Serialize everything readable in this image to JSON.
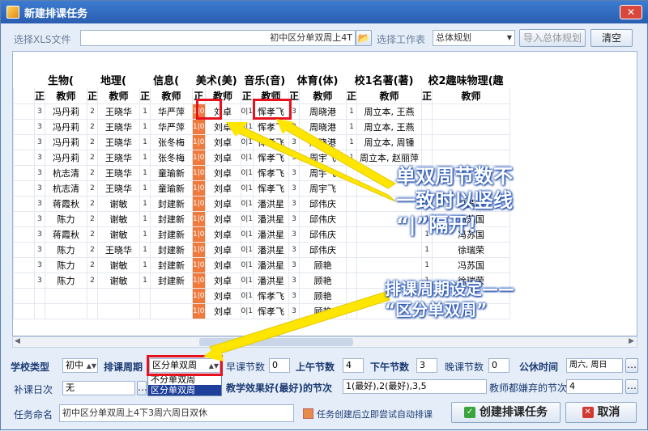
{
  "window": {
    "title": "新建排课任务"
  },
  "top": {
    "xls_label": "选择XLS文件",
    "xls_value": "初中区分单双周上4T",
    "sheet_label": "选择工作表",
    "sheet_value": "总体规划",
    "import_label": "导入总体规划",
    "clear_label": "清空"
  },
  "grid": {
    "subjects": [
      "生物(",
      "地理(",
      "信息(",
      "美术(美)",
      "音乐(音)",
      "体育(体)",
      "校1名著(著)",
      "校2趣味物理(趣"
    ],
    "sub_headers": [
      "正",
      "教师"
    ],
    "rows": [
      [
        [
          "3",
          "冯丹莉"
        ],
        [
          "2",
          "王晓华"
        ],
        [
          "1",
          "华严萍"
        ],
        [
          "1|0",
          "刘卓"
        ],
        [
          "0|1",
          "恽孝飞"
        ],
        [
          "3",
          "周晓港"
        ],
        [
          "1",
          "周立本, 王燕"
        ],
        [
          "",
          ""
        ]
      ],
      [
        [
          "3",
          "冯丹莉"
        ],
        [
          "2",
          "王晓华"
        ],
        [
          "1",
          "华严萍"
        ],
        [
          "1|0",
          "刘卓"
        ],
        [
          "0|1",
          "恽孝飞"
        ],
        [
          "3",
          "周晓港"
        ],
        [
          "1",
          "周立本, 王燕"
        ],
        [
          "",
          ""
        ]
      ],
      [
        [
          "3",
          "冯丹莉"
        ],
        [
          "2",
          "王晓华"
        ],
        [
          "1",
          "张冬梅"
        ],
        [
          "1|0",
          "刘卓"
        ],
        [
          "0|1",
          "恽孝飞"
        ],
        [
          "3",
          "周晓港"
        ],
        [
          "1",
          "周立本, 周锺"
        ],
        [
          "",
          ""
        ]
      ],
      [
        [
          "3",
          "冯丹莉"
        ],
        [
          "2",
          "王晓华"
        ],
        [
          "1",
          "张冬梅"
        ],
        [
          "1|0",
          "刘卓"
        ],
        [
          "0|1",
          "恽孝飞"
        ],
        [
          "3",
          "周宇飞"
        ],
        [
          "1",
          "周立本, 赵丽萍"
        ],
        [
          "",
          ""
        ]
      ],
      [
        [
          "3",
          "杭志清"
        ],
        [
          "2",
          "王晓华"
        ],
        [
          "1",
          "童瑜新"
        ],
        [
          "1|0",
          "刘卓"
        ],
        [
          "0|1",
          "恽孝飞"
        ],
        [
          "3",
          "周宇飞"
        ],
        [
          "",
          ""
        ],
        [
          "",
          ""
        ]
      ],
      [
        [
          "3",
          "杭志清"
        ],
        [
          "2",
          "王晓华"
        ],
        [
          "1",
          "童瑜新"
        ],
        [
          "1|0",
          "刘卓"
        ],
        [
          "0|1",
          "恽孝飞"
        ],
        [
          "3",
          "周宇飞"
        ],
        [
          "",
          ""
        ],
        [
          "",
          ""
        ]
      ],
      [
        [
          "3",
          "蒋霞秋"
        ],
        [
          "2",
          "谢敏"
        ],
        [
          "1",
          "封建新"
        ],
        [
          "1|0",
          "刘卓"
        ],
        [
          "0|1",
          "潘洪星"
        ],
        [
          "3",
          "邱伟庆"
        ],
        [
          "",
          ""
        ],
        [
          "1",
          "冯苏国"
        ]
      ],
      [
        [
          "3",
          "陈力"
        ],
        [
          "2",
          "谢敏"
        ],
        [
          "1",
          "封建新"
        ],
        [
          "1|0",
          "刘卓"
        ],
        [
          "0|1",
          "潘洪星"
        ],
        [
          "3",
          "邱伟庆"
        ],
        [
          "",
          ""
        ],
        [
          "1",
          "冯苏国"
        ]
      ],
      [
        [
          "3",
          "蒋霞秋"
        ],
        [
          "2",
          "谢敏"
        ],
        [
          "1",
          "封建新"
        ],
        [
          "1|0",
          "刘卓"
        ],
        [
          "0|1",
          "潘洪星"
        ],
        [
          "3",
          "邱伟庆"
        ],
        [
          "",
          ""
        ],
        [
          "1",
          "冯苏国"
        ]
      ],
      [
        [
          "3",
          "陈力"
        ],
        [
          "2",
          "王晓华"
        ],
        [
          "1",
          "封建新"
        ],
        [
          "1|0",
          "刘卓"
        ],
        [
          "0|1",
          "潘洪星"
        ],
        [
          "3",
          "邱伟庆"
        ],
        [
          "",
          ""
        ],
        [
          "1",
          "徐瑞荣"
        ]
      ],
      [
        [
          "3",
          "陈力"
        ],
        [
          "2",
          "谢敏"
        ],
        [
          "1",
          "封建新"
        ],
        [
          "1|0",
          "刘卓"
        ],
        [
          "0|1",
          "潘洪星"
        ],
        [
          "3",
          "顾艳"
        ],
        [
          "",
          ""
        ],
        [
          "1",
          "冯苏国"
        ]
      ],
      [
        [
          "3",
          "陈力"
        ],
        [
          "2",
          "谢敏"
        ],
        [
          "1",
          "封建新"
        ],
        [
          "1|0",
          "刘卓"
        ],
        [
          "0|1",
          "潘洪星"
        ],
        [
          "3",
          "顾艳"
        ],
        [
          "",
          ""
        ],
        [
          "1",
          "徐瑞荣"
        ]
      ],
      [
        [
          "",
          ""
        ],
        [
          "",
          ""
        ],
        [
          "",
          ""
        ],
        [
          "1|0",
          "刘卓"
        ],
        [
          "0|1",
          "恽孝飞"
        ],
        [
          "3",
          "顾艳"
        ],
        [
          "",
          ""
        ],
        [
          "",
          ""
        ]
      ],
      [
        [
          "",
          ""
        ],
        [
          "",
          ""
        ],
        [
          "",
          ""
        ],
        [
          "1|0",
          "刘卓"
        ],
        [
          "0|1",
          "恽孝飞"
        ],
        [
          "3",
          "顾艳"
        ],
        [
          "",
          ""
        ],
        [
          "",
          ""
        ]
      ]
    ]
  },
  "settings": {
    "school_type_label": "学校类型",
    "school_type_value": "初中",
    "period_label": "排课周期",
    "period_value": "区分单双周",
    "period_options": [
      "不分单双周",
      "区分单双周"
    ],
    "morning_early_label": "早课节数",
    "morning_early_value": "0",
    "morning_label": "上午节数",
    "morning_value": "4",
    "afternoon_label": "下午节数",
    "afternoon_value": "3",
    "evening_label": "晚课节数",
    "evening_value": "0",
    "public_time_label": "公休时间",
    "public_time_value": "周六, 周日",
    "makeup_label": "补课日次",
    "makeup_value": "无",
    "best_label": "教学效果好(最好)的节次",
    "best_value": "1(最好),2(最好),3,5",
    "worst_label": "教师都嫌弃的节次",
    "worst_value": "4"
  },
  "bottom": {
    "task_label": "任务命名",
    "task_value": "初中区分单双周上4下3周六周日双休",
    "auto_label": "任务创建后立即尝试自动排课",
    "create_label": "创建排课任务",
    "cancel_label": "取消"
  },
  "callouts": {
    "c1_line1": "单双周节数不",
    "c1_line2": "一致时以竖线",
    "c1_line3": "“|”隔开！",
    "c2_line1": "排课周期设定——",
    "c2_line2": "“区分单双周”"
  }
}
